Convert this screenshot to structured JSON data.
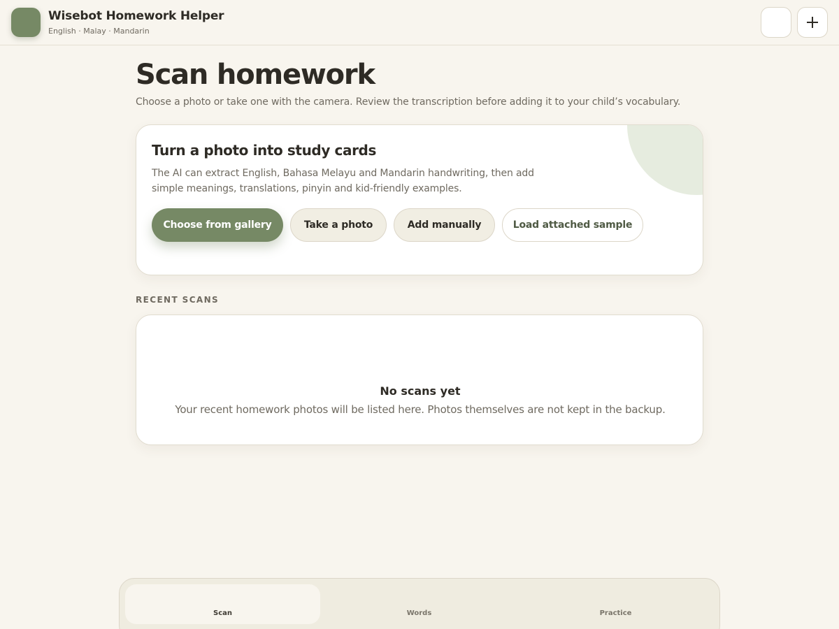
{
  "header": {
    "title": "Wisebot Homework Helper",
    "subtitle": "English · Malay · Mandarin",
    "logo_color": "#768965",
    "icons": [
      "app-logo-icon",
      "menu-icon",
      "plus-icon"
    ]
  },
  "page": {
    "title": "Scan homework",
    "description": "Choose a photo or take one with the camera. Review the transcription before adding it to your child’s vocabulary."
  },
  "hero": {
    "title": "Turn a photo into study cards",
    "text": "The AI can extract English, Bahasa Melayu and Mandarin handwriting, then add simple meanings, translations, pinyin and kid-friendly examples.",
    "buttons": {
      "gallery": "Choose from gallery",
      "photo": "Take a photo",
      "manual": "Add manually",
      "sample": "Load attached sample"
    }
  },
  "recent": {
    "section_label": "RECENT SCANS",
    "empty_title": "No scans yet",
    "empty_text": "Your recent homework photos will be listed here. Photos themselves are not kept in the backup."
  },
  "nav": {
    "tabs": [
      {
        "label": "Scan",
        "active": true
      },
      {
        "label": "Words",
        "active": false
      },
      {
        "label": "Practice",
        "active": false
      }
    ]
  },
  "colors": {
    "accent": "#768965",
    "background": "#f8f5ee",
    "surface": "#ffffff",
    "soft_button": "#f1eee3"
  }
}
